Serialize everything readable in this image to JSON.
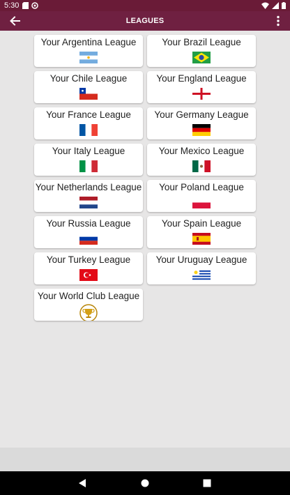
{
  "status_bar": {
    "time": "5:30",
    "icons_left": [
      "sd-card-icon",
      "sync-icon"
    ],
    "icons_right": [
      "wifi-icon",
      "signal-icon",
      "battery-icon"
    ]
  },
  "app_bar": {
    "title": "LEAGUES",
    "background": "#6f2041"
  },
  "leagues": [
    {
      "label": "Your Argentina League",
      "flag": "argentina-flag-icon"
    },
    {
      "label": "Your Brazil League",
      "flag": "brazil-flag-icon"
    },
    {
      "label": "Your Chile League",
      "flag": "chile-flag-icon"
    },
    {
      "label": "Your England League",
      "flag": "england-flag-icon"
    },
    {
      "label": "Your France League",
      "flag": "france-flag-icon"
    },
    {
      "label": "Your Germany League",
      "flag": "germany-flag-icon"
    },
    {
      "label": "Your Italy League",
      "flag": "italy-flag-icon"
    },
    {
      "label": "Your Mexico League",
      "flag": "mexico-flag-icon"
    },
    {
      "label": "Your Netherlands League",
      "flag": "netherlands-flag-icon"
    },
    {
      "label": "Your Poland League",
      "flag": "poland-flag-icon"
    },
    {
      "label": "Your Russia League",
      "flag": "russia-flag-icon"
    },
    {
      "label": "Your Spain League",
      "flag": "spain-flag-icon"
    },
    {
      "label": "Your Turkey League",
      "flag": "turkey-flag-icon"
    },
    {
      "label": "Your Uruguay League",
      "flag": "uruguay-flag-icon"
    },
    {
      "label": "Your World Club League",
      "flag": "trophy-icon"
    }
  ],
  "nav_bar": {
    "buttons": [
      "back-nav-icon",
      "home-nav-icon",
      "recents-nav-icon"
    ]
  }
}
